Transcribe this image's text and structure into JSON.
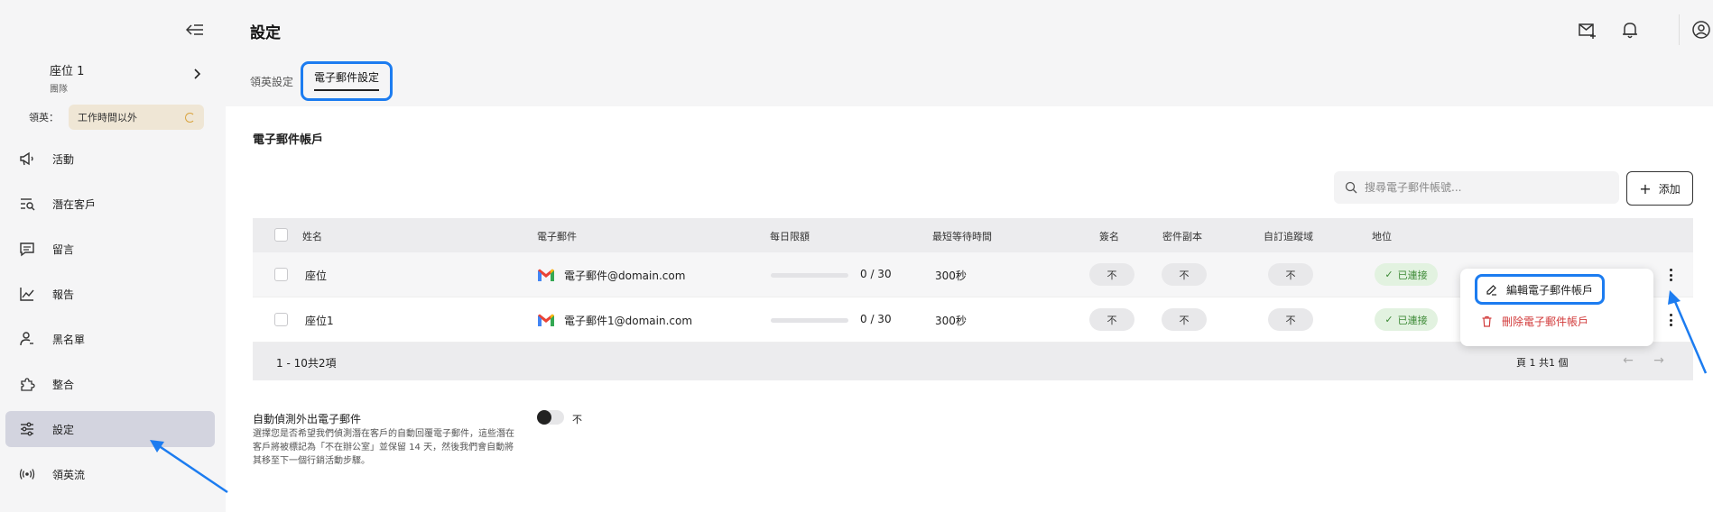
{
  "sidebar": {
    "seat_name": "座位 1",
    "seat_sub": "團隊",
    "status_label": "領英：",
    "status_value": "工作時間以外",
    "items": [
      {
        "label": "活動",
        "icon": "megaphone-icon"
      },
      {
        "label": "潛在客戶",
        "icon": "prospects-icon"
      },
      {
        "label": "留言",
        "icon": "message-icon"
      },
      {
        "label": "報告",
        "icon": "chart-icon"
      },
      {
        "label": "黑名單",
        "icon": "user-blocked-icon"
      },
      {
        "label": "整合",
        "icon": "puzzle-icon"
      },
      {
        "label": "設定",
        "icon": "sliders-icon"
      },
      {
        "label": "領英流",
        "icon": "broadcast-icon"
      }
    ]
  },
  "header": {
    "title": "設定",
    "tabs": [
      {
        "label": "領英設定"
      },
      {
        "label": "電子郵件設定"
      }
    ]
  },
  "panel": {
    "section_title": "電子郵件帳戶",
    "search_placeholder": "搜尋電子郵件帳號...",
    "add_label": "添加",
    "columns": [
      "姓名",
      "電子郵件",
      "每日限額",
      "最短等待時間",
      "簽名",
      "密件副本",
      "自訂追蹤域",
      "地位"
    ],
    "rows": [
      {
        "name": "座位",
        "email": "電子郵件@domain.com",
        "limit_used": 0,
        "limit_text": "0 / 30",
        "wait": "300秒",
        "signature": "不",
        "bcc": "不",
        "tracking": "不",
        "status": "已連接"
      },
      {
        "name": "座位1",
        "email": "電子郵件1@domain.com",
        "limit_used": 0,
        "limit_text": "0 / 30",
        "wait": "300秒",
        "signature": "不",
        "bcc": "不",
        "tracking": "不",
        "status": "已連接"
      }
    ],
    "footer_range": "1 - 10共2項",
    "footer_page": "頁 1 共1 個",
    "auto_title": "自動偵測外出電子郵件",
    "auto_desc": "選擇您是否希望我們偵測潛在客戶的自動回覆電子郵件，這些潛在客戶將被標記為「不在辦公室」並保留 14 天，然後我們會自動將其移至下一個行銷活動步驟。",
    "auto_toggle_label": "不"
  },
  "menu": {
    "edit_label": "編輯電子郵件帳戶",
    "delete_label": "刪除電子郵件帳戶"
  },
  "colors": {
    "accent": "#1c7cf0",
    "active_nav": "#d3d4df",
    "status_ok_bg": "#e2f2e0",
    "status_ok_fg": "#3d8a36",
    "danger": "#d23b3b"
  }
}
